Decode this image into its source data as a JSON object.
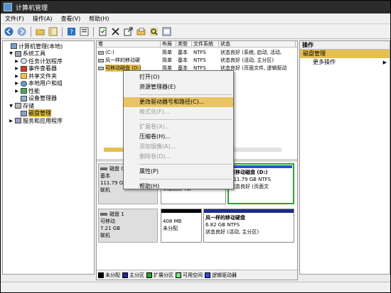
{
  "window": {
    "title": "计算机管理"
  },
  "menu": [
    "文件(F)",
    "操作(A)",
    "查看(V)",
    "帮助(H)"
  ],
  "toolbar": {
    "icons": [
      "back-icon",
      "forward-icon",
      "folder-icon",
      "properties-icon",
      "help-icon",
      "panel-icon",
      "export-icon",
      "delete-icon",
      "checklist-icon",
      "folder-open-icon",
      "magnify-icon",
      "options-icon"
    ]
  },
  "tree": {
    "items": [
      {
        "label": "计算机管理(本地)",
        "level": 0,
        "exp": ""
      },
      {
        "label": "系统工具",
        "level": 1,
        "exp": "▼"
      },
      {
        "label": "任务计划程序",
        "level": 2,
        "exp": "▶"
      },
      {
        "label": "事件查看器",
        "level": 2,
        "exp": "▶"
      },
      {
        "label": "共享文件夹",
        "level": 2,
        "exp": "▶"
      },
      {
        "label": "本地用户和组",
        "level": 2,
        "exp": "▶"
      },
      {
        "label": "性能",
        "level": 2,
        "exp": "▶"
      },
      {
        "label": "设备管理器",
        "level": 2,
        "exp": ""
      },
      {
        "label": "存储",
        "level": 1,
        "exp": "▼"
      },
      {
        "label": "磁盘管理",
        "level": 2,
        "exp": "",
        "selected": true
      },
      {
        "label": "服务和应用程序",
        "level": 1,
        "exp": "▶"
      }
    ]
  },
  "volumes": {
    "headers": [
      "卷",
      "布局",
      "类型",
      "文件系统",
      "状态"
    ],
    "rows": [
      {
        "name": "(C:)",
        "layout": "简单",
        "type": "基本",
        "fs": "NTFS",
        "status": "状态良好 (系统, 启动, 活动,"
      },
      {
        "name": "风一样的移动硬",
        "layout": "简单",
        "type": "基本",
        "fs": "NTFS",
        "status": "状态良好 (活动, 主分区)"
      },
      {
        "name": "可移动磁盘 (D:)",
        "layout": "简单",
        "type": "基本",
        "fs": "NTFS",
        "status": "状态良好 (页面文件, 逻辑驱动"
      }
    ]
  },
  "disks": [
    {
      "name": "磁盘 0",
      "type": "基本",
      "size": "111.79 GB",
      "state": "联机",
      "partitions": [
        {
          "line1": "",
          "line2": "",
          "line3": "状态良好 (系"
        },
        {
          "line1": "可移动磁盘 (D:)",
          "line2": "111.79 GB NTFS",
          "line3": "状态良好 (页面文"
        }
      ]
    },
    {
      "name": "磁盘 1",
      "type": "可移动",
      "size": "7.21 GB",
      "state": "联机",
      "partitions": [
        {
          "line1": "408 MB",
          "line2": "未分配",
          "line3": ""
        },
        {
          "line1": "风一样的移动硬盘",
          "line2": "6.82 GB NTFS",
          "line3": "状态良好 (活动, 主分区)"
        }
      ]
    }
  ],
  "legend": [
    {
      "label": "未分配",
      "color": "#000000"
    },
    {
      "label": "主分区",
      "color": "#1c2b8c"
    },
    {
      "label": "扩展分区",
      "color": "#2aa52a"
    },
    {
      "label": "可用空间",
      "color": "#7fe07f"
    },
    {
      "label": "逻辑驱动器",
      "color": "#2a4fd8"
    }
  ],
  "context_menu": [
    {
      "label": "打开(O)",
      "disabled": false
    },
    {
      "label": "资源管理器(E)",
      "disabled": false
    },
    {
      "sep": true
    },
    {
      "label": "更改驱动器号和路径(C)...",
      "disabled": false,
      "highlight": true
    },
    {
      "label": "格式化(F)...",
      "disabled": true
    },
    {
      "sep": true
    },
    {
      "label": "扩展卷(X)...",
      "disabled": true
    },
    {
      "label": "压缩卷(H)...",
      "disabled": false
    },
    {
      "label": "添加镜像(A)...",
      "disabled": true
    },
    {
      "label": "删除卷(D)...",
      "disabled": true
    },
    {
      "sep": true
    },
    {
      "label": "属性(P)",
      "disabled": false
    },
    {
      "sep": true
    },
    {
      "label": "帮助(H)",
      "disabled": false
    }
  ],
  "actions": {
    "header": "操作",
    "section": "磁盘管理",
    "more": "更多操作",
    "more_arrow": "▶"
  }
}
